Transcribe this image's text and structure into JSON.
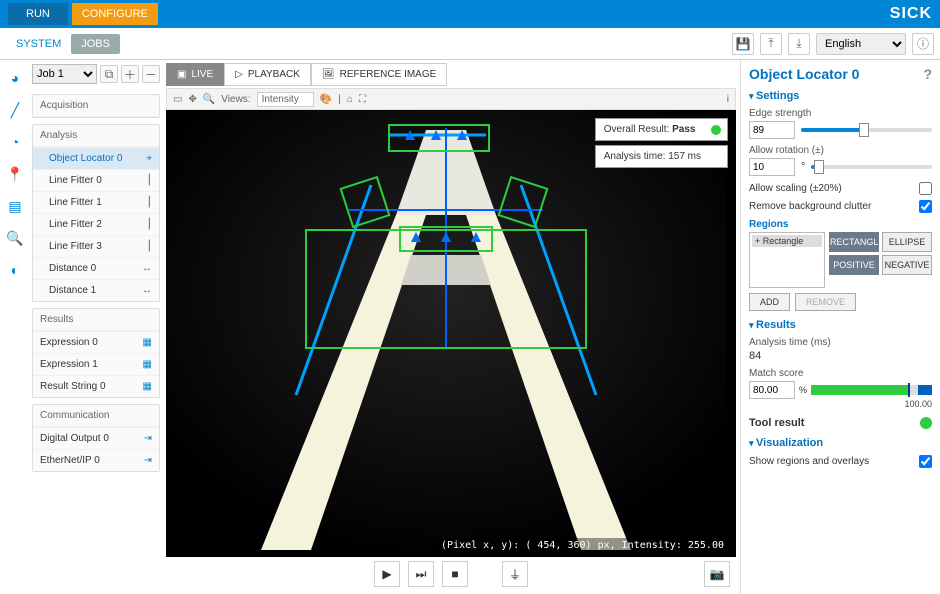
{
  "brand": "SICK",
  "topbar": {
    "run": "RUN",
    "configure": "CONFIGURE"
  },
  "subTabs": {
    "system": "SYSTEM",
    "jobs": "JOBS"
  },
  "language": "English",
  "job": {
    "current": "Job 1"
  },
  "tree": {
    "acq": "Acquisition",
    "analysis": "Analysis",
    "items": [
      "Object Locator 0",
      "Line Fitter 0",
      "Line Fitter 1",
      "Line Fitter 2",
      "Line Fitter 3",
      "Distance 0",
      "Distance 1"
    ],
    "results": "Results",
    "ritems": [
      "Expression 0",
      "Expression 1",
      "Result String 0"
    ],
    "comm": "Communication",
    "citems": [
      "Digital Output 0",
      "EtherNet/IP 0"
    ]
  },
  "viewTabs": {
    "live": "LIVE",
    "playback": "PLAYBACK",
    "ref": "REFERENCE IMAGE"
  },
  "toolbar": {
    "viewsLbl": "Views:",
    "viewsVal": "Intensity"
  },
  "status": {
    "overallLabel": "Overall Result:",
    "overallVal": "Pass",
    "timeLabel": "Analysis time:",
    "timeVal": "157 ms"
  },
  "coords": "(Pixel x, y): (  454,  360) px, Intensity:  255.00",
  "panel": {
    "title": "Object Locator 0",
    "settings": "Settings",
    "edgeLabel": "Edge strength",
    "edgeVal": "89",
    "rotLabel": "Allow rotation (±)",
    "rotVal": "10",
    "rotUnit": "°",
    "scaleLabel": "Allow scaling (±20%)",
    "bgLabel": "Remove background clutter",
    "regions": "Regions",
    "regItem": "+ Rectangle",
    "btnRect": "RECTANGLE",
    "btnEll": "ELLIPSE",
    "btnPos": "POSITIVE",
    "btnNeg": "NEGATIVE",
    "add": "ADD",
    "remove": "REMOVE",
    "results": "Results",
    "anaLbl": "Analysis time (ms)",
    "anaVal": "84",
    "msLbl": "Match score",
    "msVal": "80.00",
    "msUnit": "%",
    "msMax": "100.00",
    "tool": "Tool result",
    "viz": "Visualization",
    "showOv": "Show regions and overlays"
  }
}
